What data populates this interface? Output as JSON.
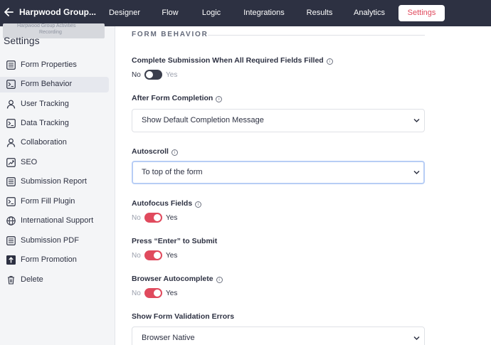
{
  "topbar": {
    "title": "Harpwood Group...",
    "tabs": [
      {
        "label": "Designer",
        "active": false
      },
      {
        "label": "Flow",
        "active": false
      },
      {
        "label": "Logic",
        "active": false
      },
      {
        "label": "Integrations",
        "active": false
      },
      {
        "label": "Results",
        "active": false
      },
      {
        "label": "Analytics",
        "active": false
      },
      {
        "label": "Settings",
        "active": true
      }
    ],
    "ghost_line1": "Harpwood Group Activities",
    "ghost_line2": "Recording"
  },
  "sidebar": {
    "title": "Settings",
    "items": [
      {
        "label": "Form Properties",
        "icon": "list-icon",
        "active": false
      },
      {
        "label": "Form Behavior",
        "icon": "terminal-icon",
        "active": true
      },
      {
        "label": "User Tracking",
        "icon": "user-icon",
        "active": false
      },
      {
        "label": "Data Tracking",
        "icon": "terminal-icon",
        "active": false
      },
      {
        "label": "Collaboration",
        "icon": "user-icon",
        "active": false
      },
      {
        "label": "SEO",
        "icon": "trend-icon",
        "active": false
      },
      {
        "label": "Submission Report",
        "icon": "list-icon",
        "active": false
      },
      {
        "label": "Form Fill Plugin",
        "icon": "terminal-icon",
        "active": false
      },
      {
        "label": "International Support",
        "icon": "globe-icon",
        "active": false
      },
      {
        "label": "Submission PDF",
        "icon": "list-icon",
        "active": false
      },
      {
        "label": "Form Promotion",
        "icon": "upload-icon",
        "active": false
      },
      {
        "label": "Delete",
        "icon": "trash-icon",
        "active": false
      }
    ]
  },
  "main": {
    "section_title": "FORM BEHAVIOR",
    "complete_submission": {
      "label": "Complete Submission When All Required Fields Filled",
      "no": "No",
      "yes": "Yes",
      "enabled": false
    },
    "after_completion": {
      "label": "After Form Completion",
      "value": "Show Default Completion Message"
    },
    "autoscroll": {
      "label": "Autoscroll",
      "value": "To top of the form"
    },
    "autofocus": {
      "label": "Autofocus Fields",
      "no": "No",
      "yes": "Yes",
      "enabled": true
    },
    "enter_submit": {
      "label": "Press “Enter” to Submit",
      "no": "No",
      "yes": "Yes",
      "enabled": true
    },
    "autocomplete": {
      "label": "Browser Autocomplete",
      "no": "No",
      "yes": "Yes",
      "enabled": true
    },
    "validation_errors": {
      "label": "Show Form Validation Errors",
      "value": "Browser Native"
    }
  },
  "colors": {
    "nav_bg": "#2d3142",
    "accent": "#e04a5d",
    "sidebar_bg": "#f4f5f7",
    "focus_border": "#b7cdf5"
  }
}
